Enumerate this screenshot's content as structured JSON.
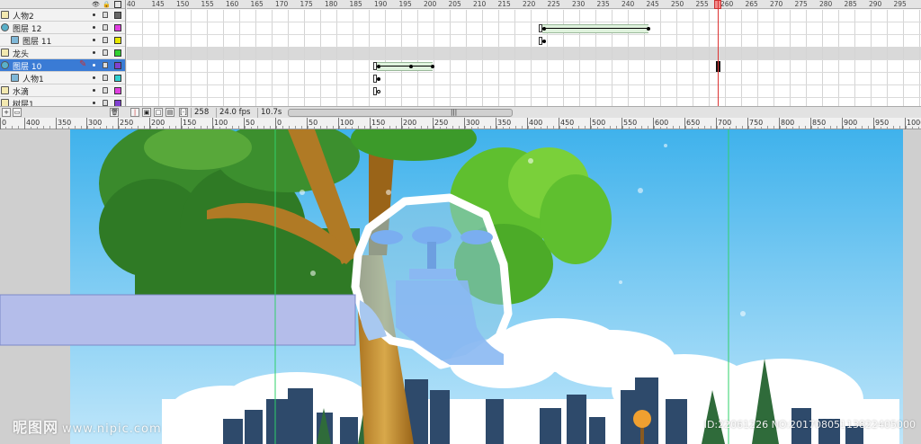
{
  "layers": [
    {
      "name": "人物2",
      "type": "normal",
      "indent": 0,
      "color": "#666666",
      "selected": false
    },
    {
      "name": "图层 12",
      "type": "mask",
      "indent": 0,
      "color": "#e040e0",
      "selected": false
    },
    {
      "name": "图层 11",
      "type": "masked",
      "indent": 1,
      "color": "#e8e800",
      "selected": false
    },
    {
      "name": "龙头",
      "type": "normal",
      "indent": 0,
      "color": "#30d030",
      "selected": false
    },
    {
      "name": "图层 10",
      "type": "mask",
      "indent": 0,
      "color": "#8040d0",
      "selected": true
    },
    {
      "name": "人物1",
      "type": "masked",
      "indent": 1,
      "color": "#30d0d0",
      "selected": false
    },
    {
      "name": "水滴",
      "type": "normal",
      "indent": 0,
      "color": "#e040e0",
      "selected": false
    },
    {
      "name": "树层1",
      "type": "normal",
      "indent": 0,
      "color": "#8040d0",
      "selected": false
    }
  ],
  "frame_numbers": [
    "40",
    "145",
    "150",
    "155",
    "160",
    "165",
    "170",
    "175",
    "180",
    "185",
    "190",
    "195",
    "200",
    "205",
    "210",
    "215",
    "220",
    "225",
    "230",
    "235",
    "240",
    "245",
    "250",
    "255",
    "260",
    "265",
    "270",
    "275",
    "280",
    "285",
    "290",
    "295"
  ],
  "timeline_status": {
    "current_frame": "258",
    "fps": "24.0 fps",
    "elapsed": "10.7s"
  },
  "stage_ruler_labels": [
    "0",
    "400",
    "350",
    "300",
    "250",
    "200",
    "150",
    "100",
    "50",
    "0",
    "50",
    "100",
    "150",
    "200",
    "250",
    "300",
    "350",
    "400",
    "450",
    "500",
    "550",
    "600",
    "650",
    "700",
    "750",
    "800",
    "850",
    "900",
    "950",
    "1000"
  ],
  "icons": {
    "eye": "eye-icon",
    "lock": "lock-icon",
    "outline": "outline-icon",
    "trash": "trash-icon"
  },
  "watermark": {
    "site_name": "昵图网",
    "site_url": "www.nipic.com",
    "id_text": "ID:22061226 NO:20170805113822405000"
  }
}
